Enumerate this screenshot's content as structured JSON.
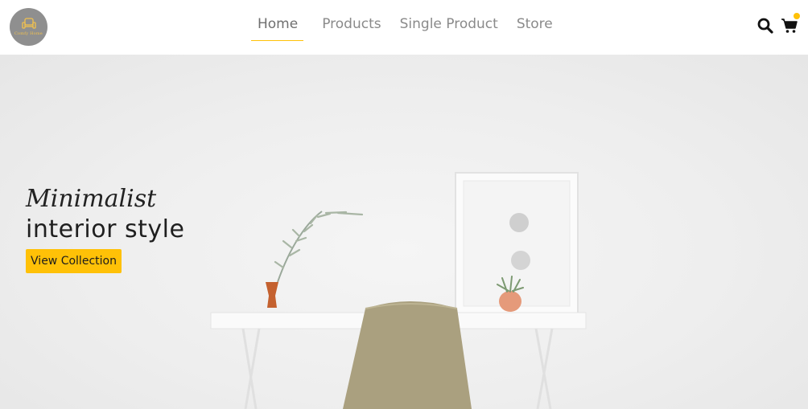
{
  "logo": {
    "text": "Comfy Home"
  },
  "nav": {
    "items": [
      {
        "label": "Home"
      },
      {
        "label": "Products"
      },
      {
        "label": "Single Product"
      },
      {
        "label": "Store"
      }
    ],
    "active": "Home"
  },
  "icons": {
    "search": "search-icon",
    "cart": "cart-icon"
  },
  "hero": {
    "title_line1": "Minimalist",
    "title_line2": "interior style",
    "button_label": "View Collection"
  },
  "colors": {
    "accent": "#ffc107",
    "text": "#222222",
    "nav_text": "#8a8a8a"
  }
}
